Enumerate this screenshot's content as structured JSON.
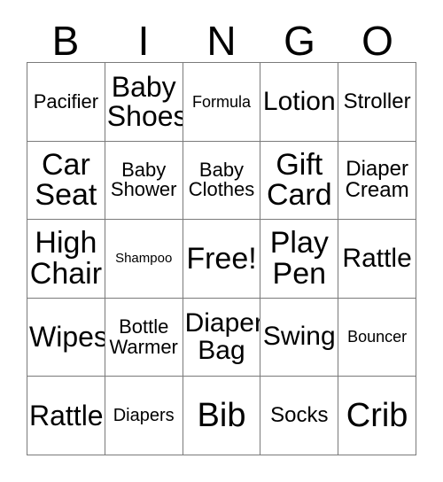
{
  "card": {
    "header_letters": [
      "B",
      "I",
      "N",
      "G",
      "O"
    ],
    "columns": 5,
    "rows": 5,
    "border_color": "#7a7a7a",
    "background_color": "#ffffff",
    "text_color": "#000000",
    "free_space_label": "Free!",
    "free_space_position": "row3-col3"
  },
  "squares": [
    {
      "text": "Pacifier",
      "size": "fs-m"
    },
    {
      "text": "Baby\nShoes",
      "size": "fs-xxl"
    },
    {
      "text": "Formula",
      "size": "fs-s"
    },
    {
      "text": "Lotion",
      "size": "fs-xl"
    },
    {
      "text": "Stroller",
      "size": "fs-ml"
    },
    {
      "text": "Car\nSeat",
      "size": "fs-3xl"
    },
    {
      "text": "Baby\nShower",
      "size": "fs-m"
    },
    {
      "text": "Baby\nClothes",
      "size": "fs-m"
    },
    {
      "text": "Gift\nCard",
      "size": "fs-3xl"
    },
    {
      "text": "Diaper\nCream",
      "size": "fs-ml"
    },
    {
      "text": "High\nChair",
      "size": "fs-3xl"
    },
    {
      "text": "Shampoo",
      "size": "fs-xs"
    },
    {
      "text": "Free!",
      "size": "fs-3xl"
    },
    {
      "text": "Play\nPen",
      "size": "fs-3xl"
    },
    {
      "text": "Rattle",
      "size": "fs-xl"
    },
    {
      "text": "Wipes",
      "size": "fs-xxl"
    },
    {
      "text": "Bottle\nWarmer",
      "size": "fs-m"
    },
    {
      "text": "Diaper\nBag",
      "size": "fs-xl"
    },
    {
      "text": "Swing",
      "size": "fs-xl"
    },
    {
      "text": "Bouncer",
      "size": "fs-s"
    },
    {
      "text": "Rattle",
      "size": "fs-xxl"
    },
    {
      "text": "Diapers",
      "size": "fs-sm"
    },
    {
      "text": "Bib",
      "size": "fs-4xl"
    },
    {
      "text": "Socks",
      "size": "fs-ml"
    },
    {
      "text": "Crib",
      "size": "fs-4xl"
    }
  ]
}
